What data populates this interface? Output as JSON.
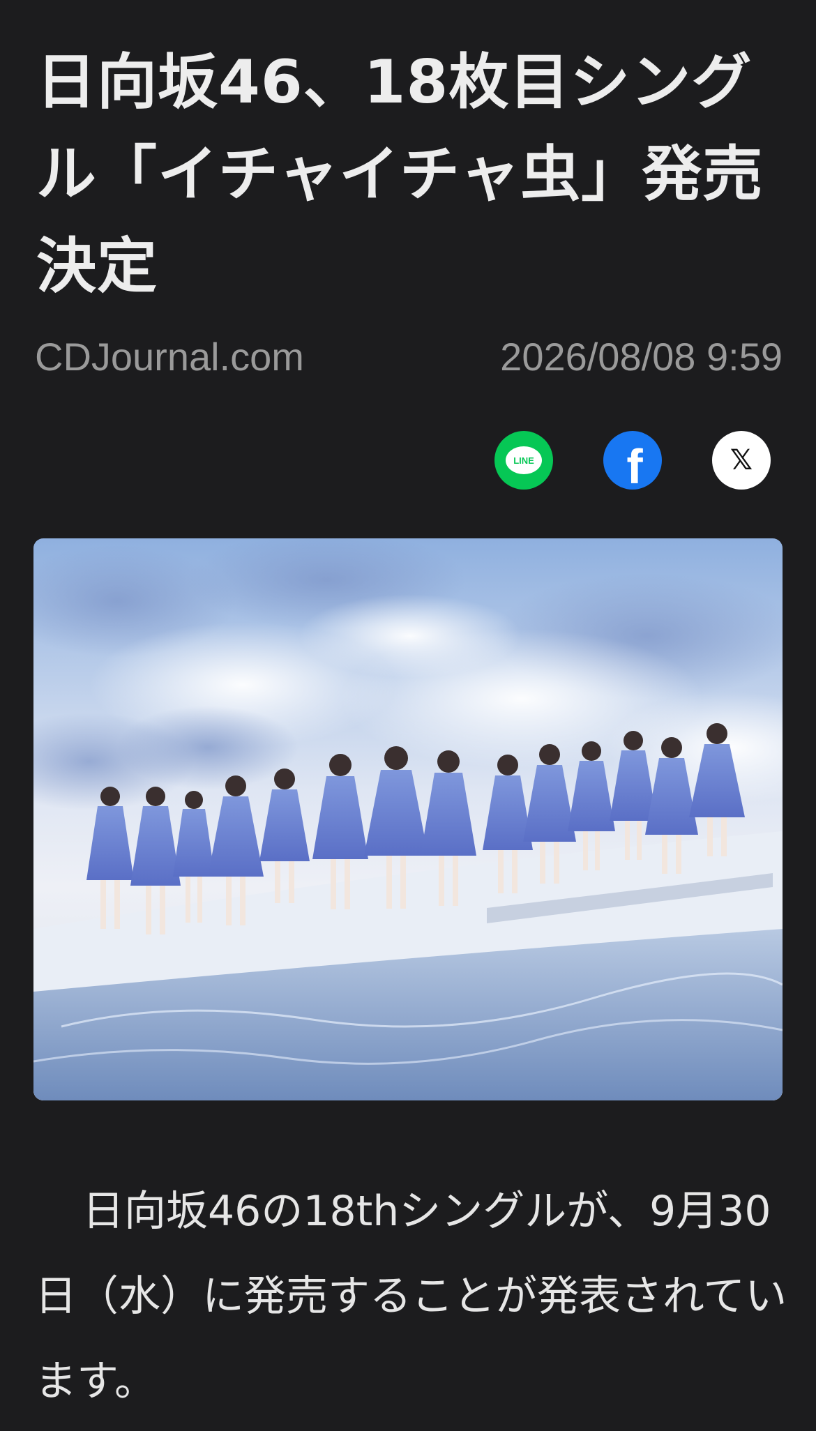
{
  "article": {
    "title": "日向坂46、18枚目シングル「イチャイチャ虫」発売決定",
    "source": "CDJournal.com",
    "timestamp": "2026/08/08 9:59",
    "body": "日向坂46の18thシングルが、9月30日（水）に発売することが発表されています。"
  },
  "share": {
    "line": {
      "icon": "line-icon",
      "label": "LINE",
      "color": "#06c755"
    },
    "facebook": {
      "icon": "facebook-icon",
      "color": "#1877f2"
    },
    "x": {
      "icon": "x-icon",
      "color": "#ffffff"
    }
  },
  "image": {
    "content": "group-photo-members-in-blue-dresses-under-sky"
  },
  "colors": {
    "background": "#1c1c1e",
    "title": "#ededed",
    "meta": "#9a9a9a",
    "body": "#e6e6e6"
  }
}
